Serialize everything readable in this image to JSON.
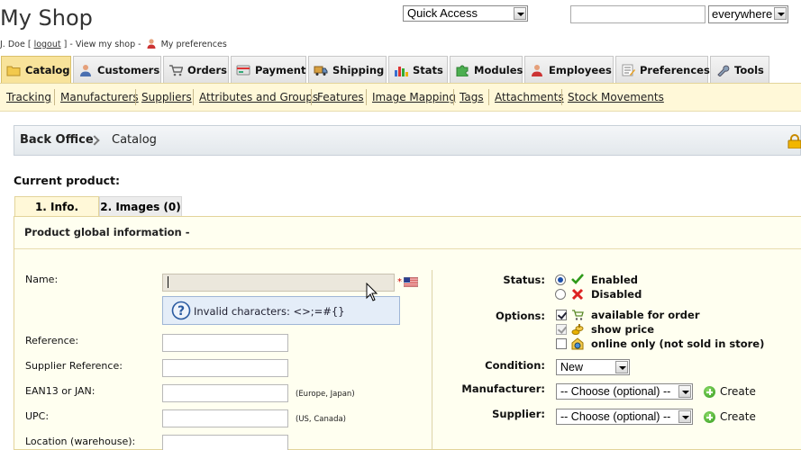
{
  "header": {
    "shop_title": "My Shop",
    "user_name": "J. Doe",
    "logout_label": "logout",
    "view_shop_label": "View my shop",
    "preferences_label": "My preferences",
    "quick_access": "Quick Access",
    "search_scope": "everywhere"
  },
  "tabs": [
    {
      "label": "Catalog",
      "icon": "catalog-folder-icon",
      "active": true
    },
    {
      "label": "Customers",
      "icon": "customer-person-icon"
    },
    {
      "label": "Orders",
      "icon": "cart-icon"
    },
    {
      "label": "Payment",
      "icon": "payment-card-icon"
    },
    {
      "label": "Shipping",
      "icon": "truck-icon"
    },
    {
      "label": "Stats",
      "icon": "bar-chart-icon"
    },
    {
      "label": "Modules",
      "icon": "puzzle-icon"
    },
    {
      "label": "Employees",
      "icon": "employee-icon"
    },
    {
      "label": "Preferences",
      "icon": "preferences-icon"
    },
    {
      "label": "Tools",
      "icon": "wrench-icon"
    }
  ],
  "subnav": [
    "Tracking",
    "Manufacturers",
    "Suppliers",
    "Attributes and Groups",
    "Features",
    "Image Mapping",
    "Tags",
    "Attachments",
    "Stock Movements"
  ],
  "breadcrumb": {
    "home": "Back Office",
    "current": "Catalog"
  },
  "product": {
    "current_label": "Current product:",
    "tabs": [
      "1. Info.",
      "2. Images (0)"
    ],
    "section_title": "Product global information -",
    "name_label": "Name:",
    "name_required": "*",
    "tooltip": "Invalid characters: <>;=#{}",
    "fields": [
      {
        "label": "Reference:",
        "hint": ""
      },
      {
        "label": "Supplier Reference:",
        "hint": ""
      },
      {
        "label": "EAN13 or JAN:",
        "hint": "(Europe, Japan)"
      },
      {
        "label": "UPC:",
        "hint": "(US, Canada)"
      },
      {
        "label": "Location (warehouse):",
        "hint": ""
      }
    ],
    "status_label": "Status:",
    "status_options": [
      {
        "label": "Enabled",
        "checked": true
      },
      {
        "label": "Disabled",
        "checked": false
      }
    ],
    "options_label": "Options:",
    "options": [
      {
        "label": "available for order",
        "checked": true,
        "enabled": true
      },
      {
        "label": "show price",
        "checked": true,
        "enabled": false
      },
      {
        "label": "online only (not sold in store)",
        "checked": false,
        "enabled": true
      }
    ],
    "condition_label": "Condition:",
    "condition_value": "New",
    "manufacturer_label": "Manufacturer:",
    "manufacturer_value": "-- Choose (optional) --",
    "supplier_label": "Supplier:",
    "supplier_value": "-- Choose (optional) --",
    "create_label": "Create"
  }
}
